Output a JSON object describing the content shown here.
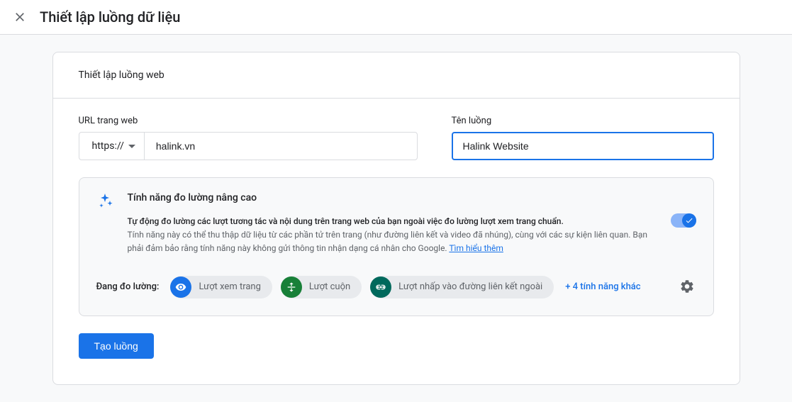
{
  "header": {
    "title": "Thiết lập luồng dữ liệu"
  },
  "card": {
    "section_title": "Thiết lập luồng web",
    "url_label": "URL trang web",
    "protocol": "https://",
    "url_value": "halink.vn",
    "name_label": "Tên luồng",
    "name_value": "Halink Website"
  },
  "enhanced": {
    "title": "Tính năng đo lường nâng cao",
    "description": "Tự động đo lường các lượt tương tác và nội dung trên trang web của bạn ngoài việc đo lường lượt xem trang chuẩn.",
    "note": "Tính năng này có thể thu thập dữ liệu từ các phần tử trên trang (như đường liên kết và video đã nhúng), cùng với các sự kiện liên quan. Bạn phải đảm bảo rằng tính năng này không gửi thông tin nhận dạng cá nhân cho Google.",
    "learn_more": "Tìm hiểu thêm",
    "measuring_label": "Đang đo lường:",
    "chips": [
      {
        "label": "Lượt xem trang"
      },
      {
        "label": "Lượt cuộn"
      },
      {
        "label": "Lượt nhấp vào đường liên kết ngoài"
      }
    ],
    "more": "+ 4 tính năng khác"
  },
  "actions": {
    "create": "Tạo luồng"
  }
}
